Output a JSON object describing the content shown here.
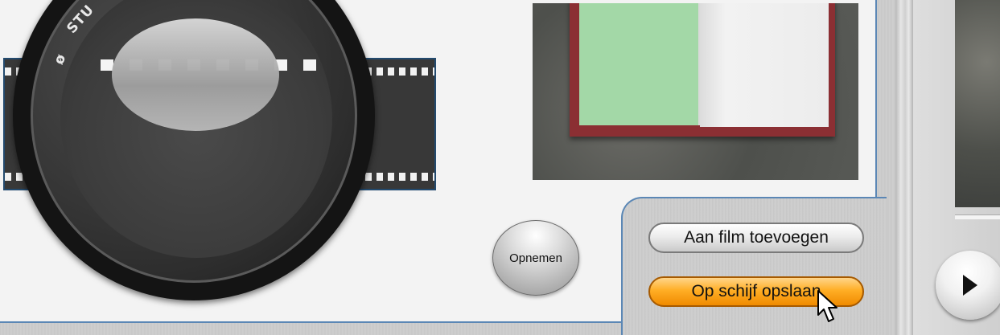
{
  "lens": {
    "text_a": "ø",
    "text_b": "STU"
  },
  "buttons": {
    "record_label": "Opnemen",
    "add_to_film_label": "Aan film toevoegen",
    "save_to_disk_label": "Op schijf opslaan"
  },
  "icons": {
    "play": "play-icon",
    "cursor": "mouse-cursor-icon"
  },
  "colors": {
    "accent_border": "#5b87b5",
    "save_button": "#ffae25"
  }
}
